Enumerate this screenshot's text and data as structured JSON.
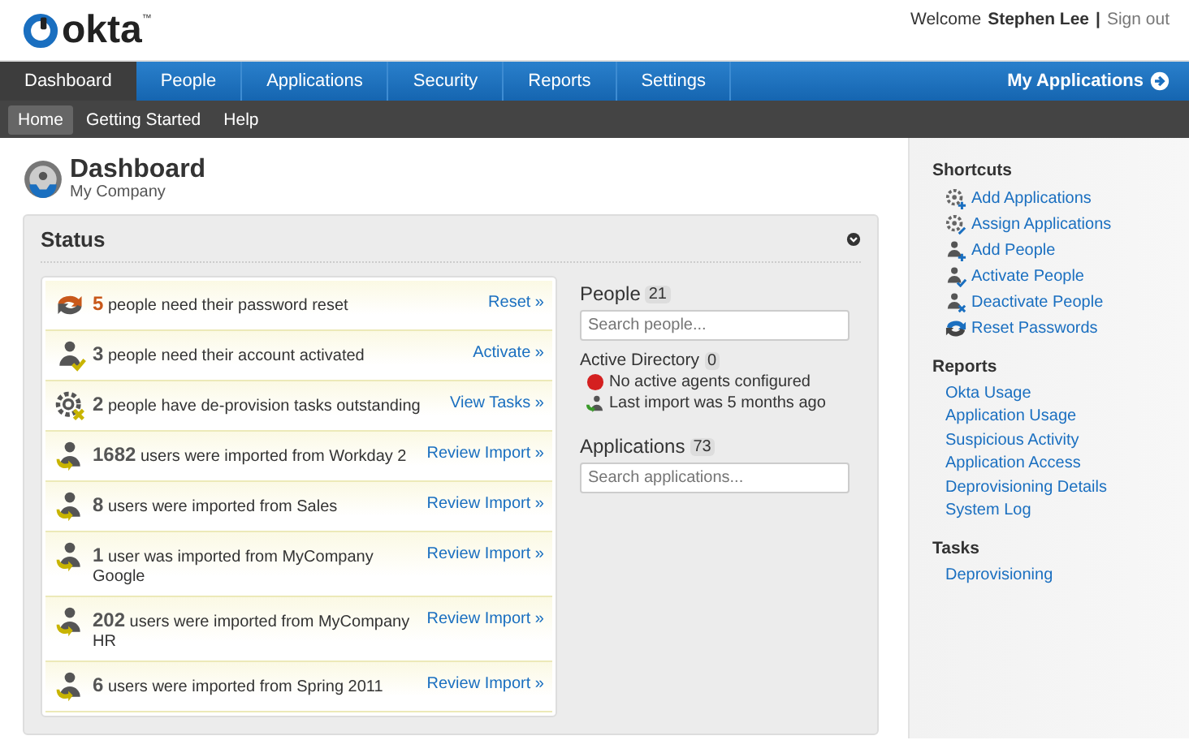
{
  "logo": {
    "text": "okta",
    "mark": "™"
  },
  "user_bar": {
    "welcome": "Welcome",
    "name": "Stephen Lee",
    "separator": "|",
    "sign_out": "Sign out"
  },
  "nav": {
    "tabs": [
      {
        "label": "Dashboard",
        "selected": true
      },
      {
        "label": "People",
        "selected": false
      },
      {
        "label": "Applications",
        "selected": false
      },
      {
        "label": "Security",
        "selected": false
      },
      {
        "label": "Reports",
        "selected": false
      },
      {
        "label": "Settings",
        "selected": false
      }
    ],
    "my_applications": "My Applications"
  },
  "subnav": [
    {
      "label": "Home",
      "selected": true
    },
    {
      "label": "Getting Started",
      "selected": false
    },
    {
      "label": "Help",
      "selected": false
    }
  ],
  "page": {
    "title": "Dashboard",
    "subtitle": "My Company"
  },
  "status": {
    "title": "Status",
    "items": [
      {
        "kind": "reset",
        "count": "5",
        "text": "people need their password reset",
        "action": "Reset »"
      },
      {
        "kind": "activate",
        "count": "3",
        "text": "people need their account activated",
        "action": "Activate »"
      },
      {
        "kind": "deprovision",
        "count": "2",
        "text": "people have de-provision tasks outstanding",
        "action": "View Tasks »"
      },
      {
        "kind": "import",
        "count": "1682",
        "text": "users were imported from Workday 2",
        "action": "Review Import »"
      },
      {
        "kind": "import",
        "count": "8",
        "text": "users were imported from Sales",
        "action": "Review Import »"
      },
      {
        "kind": "import",
        "count": "1",
        "text": "user was imported from MyCompany Google",
        "action": "Review Import »"
      },
      {
        "kind": "import",
        "count": "202",
        "text": "users were imported from MyCompany HR",
        "action": "Review Import »"
      },
      {
        "kind": "import",
        "count": "6",
        "text": "users were imported from Spring 2011",
        "action": "Review Import »"
      }
    ]
  },
  "people": {
    "title": "People",
    "count": "21",
    "search_placeholder": "Search people...",
    "directory": {
      "title": "Active Directory",
      "count": "0",
      "lines": [
        {
          "kind": "error",
          "text": "No active agents configured"
        },
        {
          "kind": "import",
          "text": "Last import was 5 months ago"
        }
      ]
    }
  },
  "applications": {
    "title": "Applications",
    "count": "73",
    "search_placeholder": "Search applications..."
  },
  "sidebar": {
    "sections": [
      {
        "title": "Shortcuts",
        "items": [
          {
            "kind": "add-app",
            "label": "Add Applications"
          },
          {
            "kind": "assign-app",
            "label": "Assign Applications"
          },
          {
            "kind": "add-person",
            "label": "Add People"
          },
          {
            "kind": "activate-person",
            "label": "Activate People"
          },
          {
            "kind": "deactivate-person",
            "label": "Deactivate People"
          },
          {
            "kind": "reset",
            "label": "Reset Passwords"
          }
        ]
      },
      {
        "title": "Reports",
        "items": [
          {
            "label": "Okta Usage"
          },
          {
            "label": "Application Usage"
          },
          {
            "label": "Suspicious Activity"
          },
          {
            "label": "Application Access"
          },
          {
            "label": "Deprovisioning Details"
          },
          {
            "label": "System Log"
          }
        ]
      },
      {
        "title": "Tasks",
        "items": [
          {
            "label": "Deprovisioning"
          }
        ]
      }
    ]
  }
}
